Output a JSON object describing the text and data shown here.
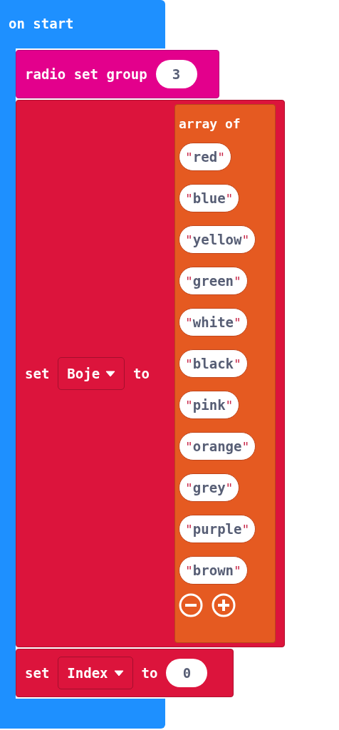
{
  "event_block": {
    "label": "on start"
  },
  "radio_block": {
    "label": "radio set group",
    "value": "3"
  },
  "set_blocks": [
    {
      "kind": "array",
      "set_label": "set",
      "variable": "Boje",
      "to_label": "to",
      "array": {
        "label": "array of",
        "items": [
          {
            "open": "\"",
            "text": "red",
            "close": "\""
          },
          {
            "open": "\"",
            "text": "blue",
            "close": "\""
          },
          {
            "open": "\"",
            "text": "yellow",
            "close": "\""
          },
          {
            "open": "\"",
            "text": "green",
            "close": "\""
          },
          {
            "open": "\"",
            "text": "white",
            "close": "\""
          },
          {
            "open": "\"",
            "text": "black",
            "close": "\""
          },
          {
            "open": "\"",
            "text": "pink",
            "close": "\""
          },
          {
            "open": "\"",
            "text": "orange",
            "close": "\""
          },
          {
            "open": "\"",
            "text": "grey",
            "close": "\""
          },
          {
            "open": "\"",
            "text": "purple",
            "close": "\""
          },
          {
            "open": "\"",
            "text": "brown",
            "close": "\""
          }
        ]
      }
    },
    {
      "kind": "number",
      "set_label": "set",
      "variable": "Index",
      "to_label": "to",
      "value": "0"
    }
  ]
}
